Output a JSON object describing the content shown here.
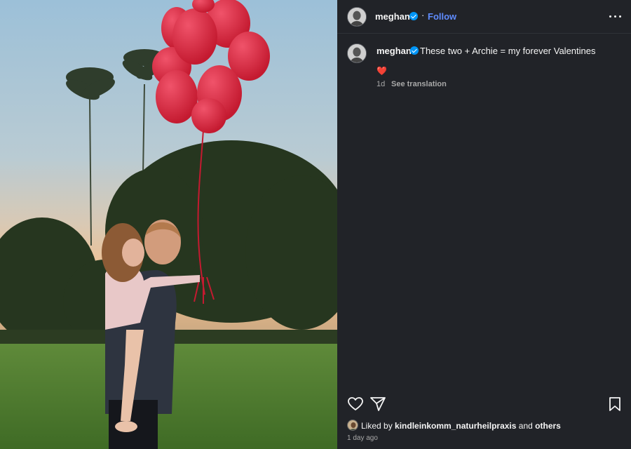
{
  "post": {
    "username": "meghan",
    "separator": "·",
    "follow_label": "Follow",
    "caption_username": "meghan",
    "caption": "These two + Archie = my forever Valentines",
    "caption_emoji": "❤️",
    "time_short": "1d",
    "see_translation": "See translation",
    "liked_by_prefix": "Liked by",
    "liked_by_user": "kindleinkomm_naturheilpraxis",
    "liked_by_and": "and",
    "liked_by_others": "others",
    "time_ago": "1 day ago"
  },
  "icons": {
    "more": "more-options-icon",
    "like": "heart-icon",
    "share": "send-icon",
    "save": "bookmark-icon",
    "verified": "verified-badge-icon"
  },
  "colors": {
    "panel_bg": "#212328",
    "accent": "#5f8cff",
    "verified": "#0095f6",
    "muted_text": "#a8a8a8",
    "balloons": "#d8263b"
  }
}
